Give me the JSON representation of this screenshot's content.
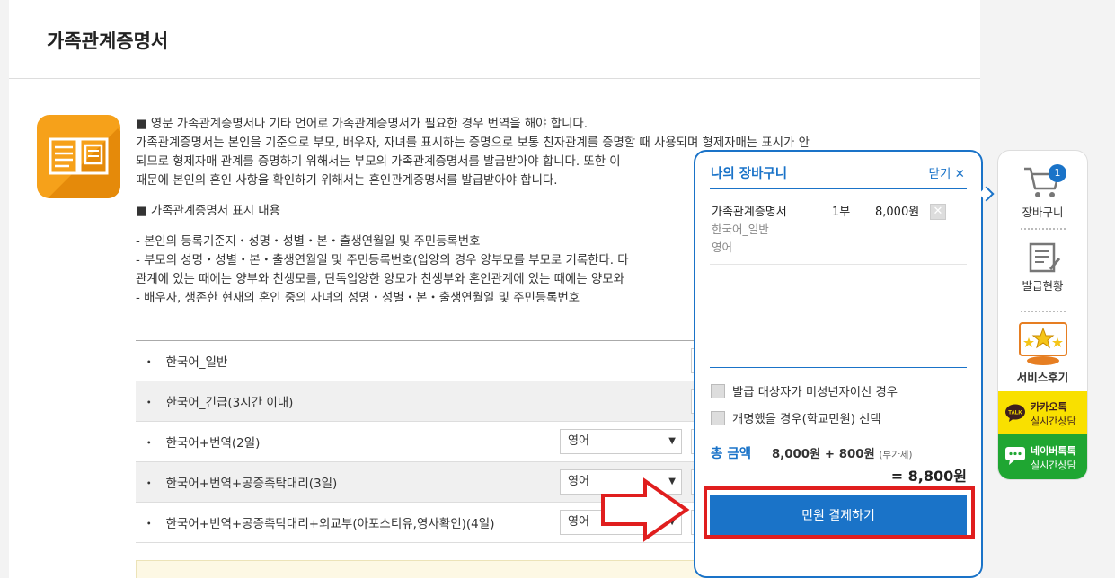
{
  "page": {
    "title": "가족관계증명서"
  },
  "description": {
    "lines": [
      "■ 영문 가족관계증명서나 기타 언어로 가족관계증명서가 필요한 경우 번역을 해야 합니다.",
      "가족관계증명서는 본인을 기준으로 부모, 배우자, 자녀를 표시하는 증명으로 보통 친자관계를 증명할 때 사용되며 형제자매는 표시가 안",
      "되므로 형제자매 관계를 증명하기 위해서는 부모의 가족관계증명서를 발급받아야 합니다. 또한 이",
      "때문에 본인의 혼인 사항을 확인하기 위해서는 혼인관계증명서를 발급받아야 합니다."
    ],
    "section_title": "■ 가족관계증명서 표시 내용",
    "items": [
      "- 본인의 등록기준지・성명・성별・본・출생연월일 및 주민등록번호",
      "- 부모의 성명・성별・본・출생연월일 및 주민등록번호(입양의 경우 양부모를 부모로 기록한다. 다",
      "관계에 있는 때에는 양부와 친생모를, 단독입양한 양모가 친생부와 혼인관계에 있는 때에는 양모와",
      "- 배우자, 생존한 현재의 혼인 중의 자녀의 성명・성별・본・출생연월일 및 주민등록번호"
    ]
  },
  "options": [
    {
      "label": "한국어_일반",
      "select": ""
    },
    {
      "label": "한국어_긴급(3시간 이내)",
      "select": ""
    },
    {
      "label": "한국어+번역(2일)",
      "select": "영어"
    },
    {
      "label": "한국어+번역+공증촉탁대리(3일)",
      "select": "영어"
    },
    {
      "label": "한국어+번역+공증촉탁대리+외교부(아포스티유,영사확인)(4일)",
      "select": "영어"
    }
  ],
  "bullet": "・",
  "cart": {
    "title": "나의 장바구니",
    "close": "닫기 ✕",
    "item": {
      "name": "가족관계증명서",
      "sub1": "한국어_일반",
      "sub2": "영어",
      "qty": "1부",
      "price": "8,000원",
      "remove": "✕"
    },
    "check1": "발급 대상자가 미성년자이신 경우",
    "check2": "개명했을 경우(학교민원) 선택",
    "total_label": "총 금액",
    "total_calc": "8,000원 + 800원",
    "vat": "(부가세)",
    "total_final": "= 8,800원",
    "pay_button": "민원 결제하기"
  },
  "side": {
    "cart_badge": "1",
    "cart_label": "장바구니",
    "issue_label": "발급현황",
    "review_label": "서비스후기",
    "kakao_title": "카카오톡",
    "kakao_sub": "실시간상담",
    "kakao_icon_text": "TALK",
    "naver_title": "네이버톡톡",
    "naver_sub": "실시간상담"
  },
  "colors": {
    "accent": "#1a73c8",
    "highlight": "#e01e1e",
    "icon_bg": "#f6a11a",
    "kakao": "#f9e000",
    "naver": "#1fa632"
  }
}
